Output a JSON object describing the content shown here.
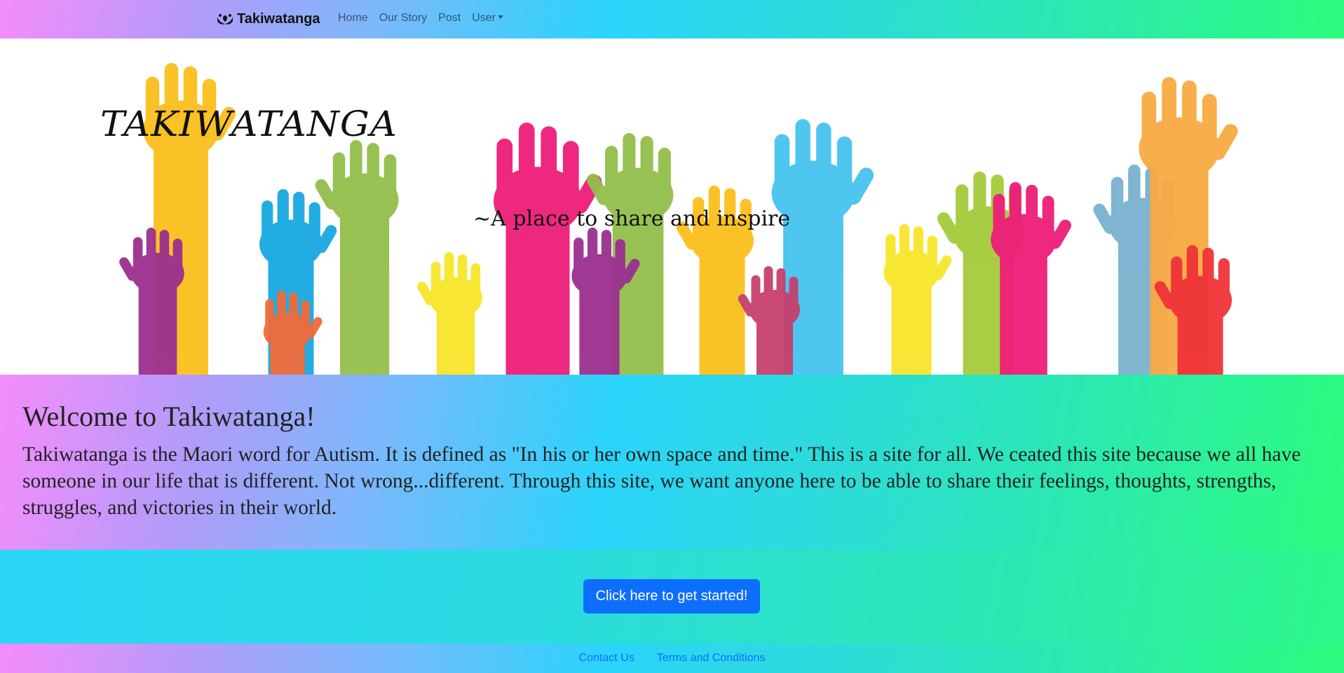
{
  "navbar": {
    "brand": "Takiwatanga",
    "links": [
      "Home",
      "Our Story",
      "Post"
    ],
    "dropdown": "User"
  },
  "hero": {
    "title": "TAKIWATANGA",
    "tagline": "~A place to share and inspire"
  },
  "welcome": {
    "heading": "Welcome to Takiwatanga!",
    "body": "Takiwatanga is the Maori word for Autism. It is defined as \"In his or her own space and time.\" This is a site for all. We ceated this site because we all have someone in our life that is different. Not wrong...different. Through this site, we want anyone here to be able to share their feelings, thoughts, strengths, struggles, and victories in their world."
  },
  "cta": {
    "label": "Click here to get started!"
  },
  "footer": {
    "links": [
      "Contact Us",
      "Terms and Conditions"
    ]
  },
  "colors": {
    "primary": "#0d6efd",
    "gradient_start": "#f58cfc",
    "gradient_mid": "#2bd4fb",
    "gradient_end": "#2efc7e"
  }
}
